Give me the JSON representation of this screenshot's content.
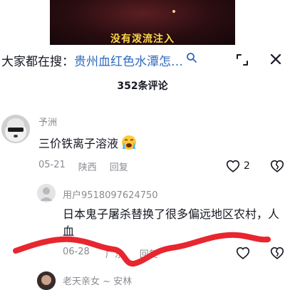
{
  "video": {
    "caption": "没有泼流注入"
  },
  "search": {
    "prefix": "大家都在搜：",
    "term": "贵州血红色水潭怎…"
  },
  "comments_header": {
    "count_label": "352条评论"
  },
  "comments": [
    {
      "author": "予洲",
      "text": "三价铁离子溶液",
      "emoji": "loudly-crying-face",
      "date": "05-21",
      "location": "陕西",
      "reply_label": "回复",
      "like_count": "2"
    },
    {
      "author": "用户9518097624750",
      "text": "日本鬼子屠杀替换了很多偏远地区农村，人血",
      "date": "06-28",
      "location": "广东",
      "reply_label": "回复"
    },
    {
      "author": "老天亲女 ~ 安林"
    }
  ],
  "colors": {
    "link_blue": "#2f6bbf",
    "meta_gray": "#8a8b91",
    "scribble_red": "#e8262f",
    "caption_yellow": "#ffd84a"
  },
  "icons": [
    "search-icon",
    "expand-icon",
    "close-icon",
    "heart-icon",
    "dislike-heart-icon",
    "loudly-crying-face-icon",
    "default-avatar-icon"
  ]
}
